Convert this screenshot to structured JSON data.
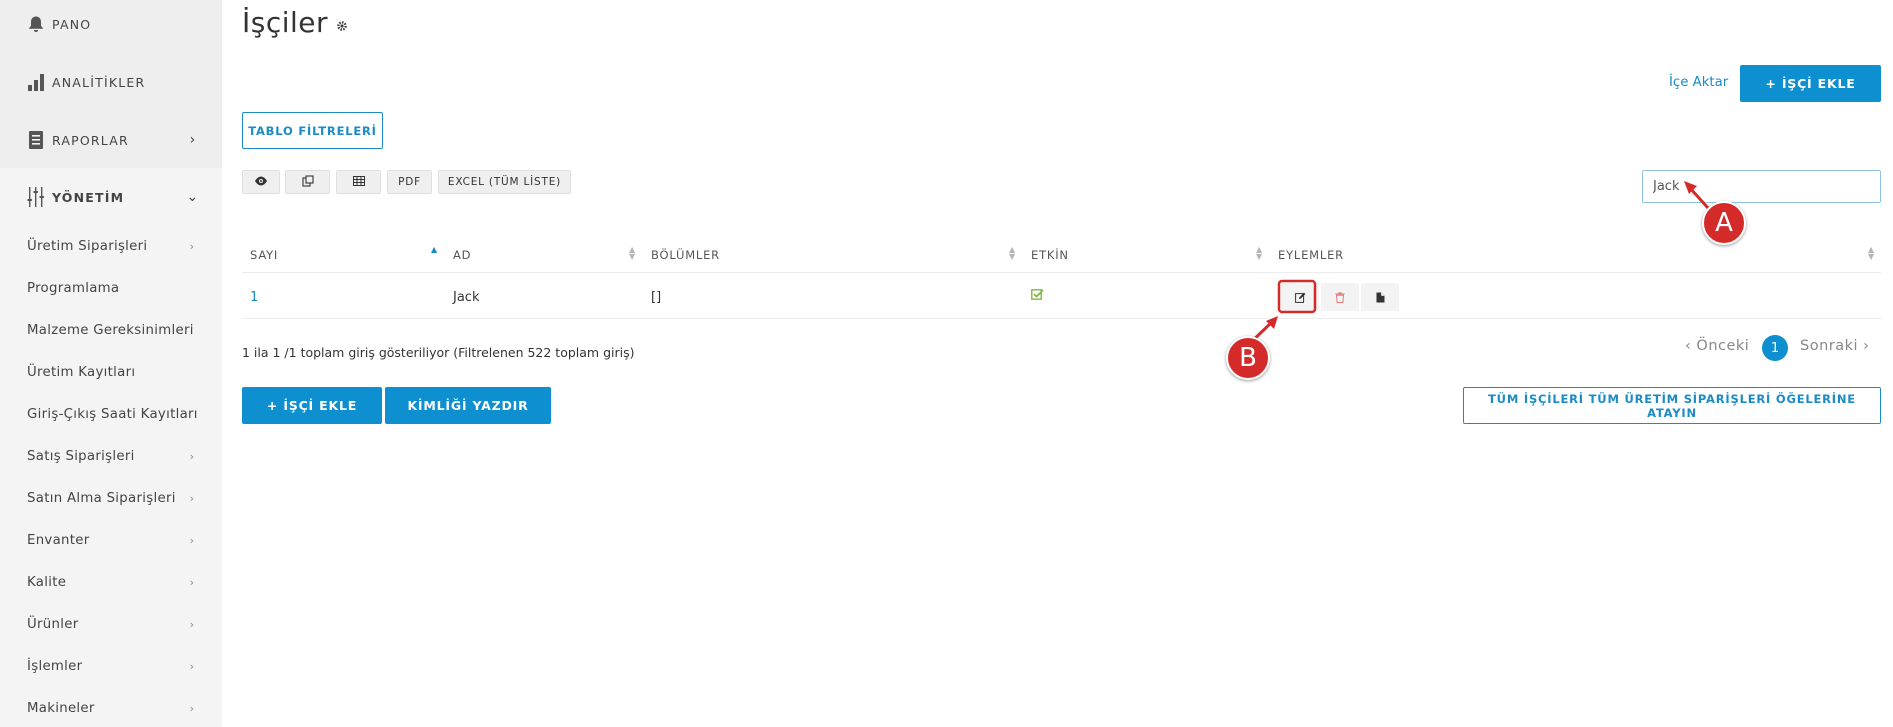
{
  "sidebar": {
    "main_items": [
      {
        "label": "PANO",
        "icon": "bell-icon"
      },
      {
        "label": "ANALİTİKLER",
        "icon": "bar-chart-icon"
      },
      {
        "label": "RAPORLAR",
        "icon": "report-icon"
      },
      {
        "label": "YÖNETİM",
        "icon": "sliders-icon"
      }
    ],
    "sub_items": [
      {
        "label": "Üretim Siparişleri",
        "has_chevron": true
      },
      {
        "label": "Programlama",
        "has_chevron": false
      },
      {
        "label": "Malzeme Gereksinimleri",
        "has_chevron": false
      },
      {
        "label": "Üretim Kayıtları",
        "has_chevron": false
      },
      {
        "label": "Giriş-Çıkış Saati Kayıtları",
        "has_chevron": false
      },
      {
        "label": "Satış Siparişleri",
        "has_chevron": true
      },
      {
        "label": "Satın Alma Siparişleri",
        "has_chevron": true
      },
      {
        "label": "Envanter",
        "has_chevron": true
      },
      {
        "label": "Kalite",
        "has_chevron": true
      },
      {
        "label": "Ürünler",
        "has_chevron": true
      },
      {
        "label": "İşlemler",
        "has_chevron": true
      },
      {
        "label": "Makineler",
        "has_chevron": true
      }
    ]
  },
  "header": {
    "title": "İşçiler",
    "import_label": "İçe Aktar",
    "add_worker_label": "+ İŞÇİ EKLE"
  },
  "toolbar": {
    "table_filters_label": "TABLO FİLTRELERİ",
    "pdf_label": "PDF",
    "excel_label": "EXCEL (TÜM LİSTE)"
  },
  "search": {
    "value": "Jack"
  },
  "table": {
    "columns": [
      "SAYI",
      "AD",
      "BÖLÜMLER",
      "ETKİN",
      "EYLEMLER"
    ],
    "rows": [
      {
        "sayi": "1",
        "ad": "Jack",
        "bolumler": "[]",
        "etkin": true
      }
    ]
  },
  "footer": {
    "info": "1 ila 1 /1 toplam giriş gösteriliyor (Filtrelenen 522 toplam giriş)",
    "prev_label": "‹ Önceki",
    "current_page": "1",
    "next_label": "Sonraki ›",
    "add_worker_label": "+ İŞÇİ EKLE",
    "print_id_label": "KİMLİĞİ YAZDIR",
    "assign_all_label": "TÜM İŞÇİLERİ TÜM ÜRETİM SİPARİŞLERİ ÖĞELERİNE ATAYIN"
  },
  "annotations": {
    "a": "A",
    "b": "B"
  },
  "colors": {
    "accent": "#0e8fcf",
    "annotation": "#d42a2a",
    "check": "#7dbb3c"
  }
}
